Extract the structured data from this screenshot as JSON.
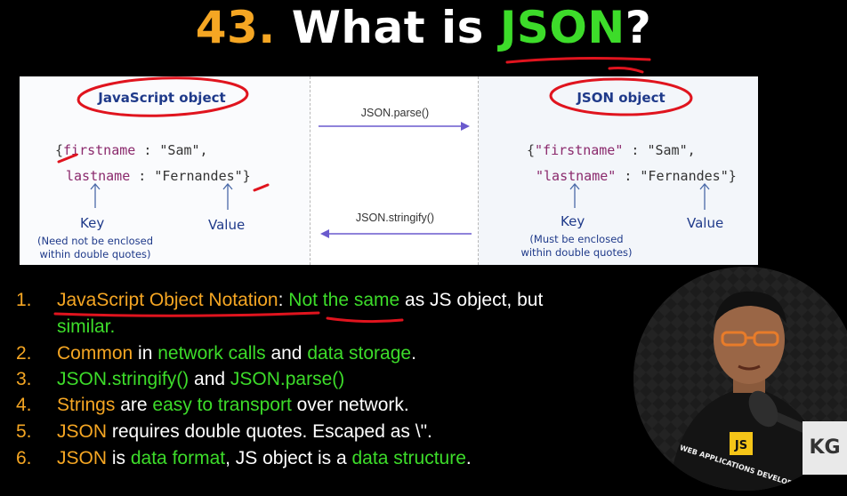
{
  "title": {
    "number": "43.",
    "text": "What is ",
    "highlight": "JSON",
    "end": "?"
  },
  "diagram": {
    "left": {
      "title": "JavaScript object",
      "line1_open": "{",
      "line1_key": "firstname",
      "line1_rest": " : \"Sam\",",
      "line2_key": "lastname",
      "line2_rest": " : \"Fernandes\"}",
      "key_label": "Key",
      "value_label": "Value",
      "note_line1": "(Need not be enclosed",
      "note_line2": "within double quotes)"
    },
    "middle": {
      "parse_label": "JSON.parse()",
      "stringify_label": "JSON.stringify()"
    },
    "right": {
      "title": "JSON object",
      "line1_open": "{",
      "line1_key": "\"firstname\"",
      "line1_rest": " : \"Sam\",",
      "line2_key": "\"lastname\"",
      "line2_rest": " : \"Fernandes\"}",
      "key_label": "Key",
      "value_label": "Value",
      "note_line1": "(Must be enclosed",
      "note_line2": "within double quotes)"
    }
  },
  "points": [
    {
      "number": "1.",
      "parts": [
        "JavaScript Object Notation",
        ": ",
        "Not the same",
        " as JS object, but"
      ],
      "line2": "similar."
    },
    {
      "number": "2.",
      "parts": [
        "Common",
        " in ",
        "network calls",
        " and ",
        "data storage",
        "."
      ]
    },
    {
      "number": "3.",
      "parts": [
        "JSON.stringify()",
        " and ",
        "JSON.parse()"
      ]
    },
    {
      "number": "4.",
      "parts": [
        "Strings",
        " are ",
        "easy to transport",
        " over network."
      ]
    },
    {
      "number": "5.",
      "parts": [
        "JSON",
        " requires double quotes. Escaped as \\\"."
      ]
    },
    {
      "number": "6.",
      "parts": [
        "JSON",
        " is ",
        "data format",
        ", JS object is a ",
        "data structure",
        "."
      ]
    }
  ],
  "webcam": {
    "shirt_text": "WEB APPLICATIONS DEVELOPER",
    "js_badge": "JS"
  },
  "watermark": "KG",
  "colors": {
    "accent_orange": "#f5a623",
    "accent_green": "#3ddc2a",
    "annotation_red": "#e0141e",
    "diagram_blue": "#1f3a8a",
    "arrow_purple": "#6a5acd"
  }
}
